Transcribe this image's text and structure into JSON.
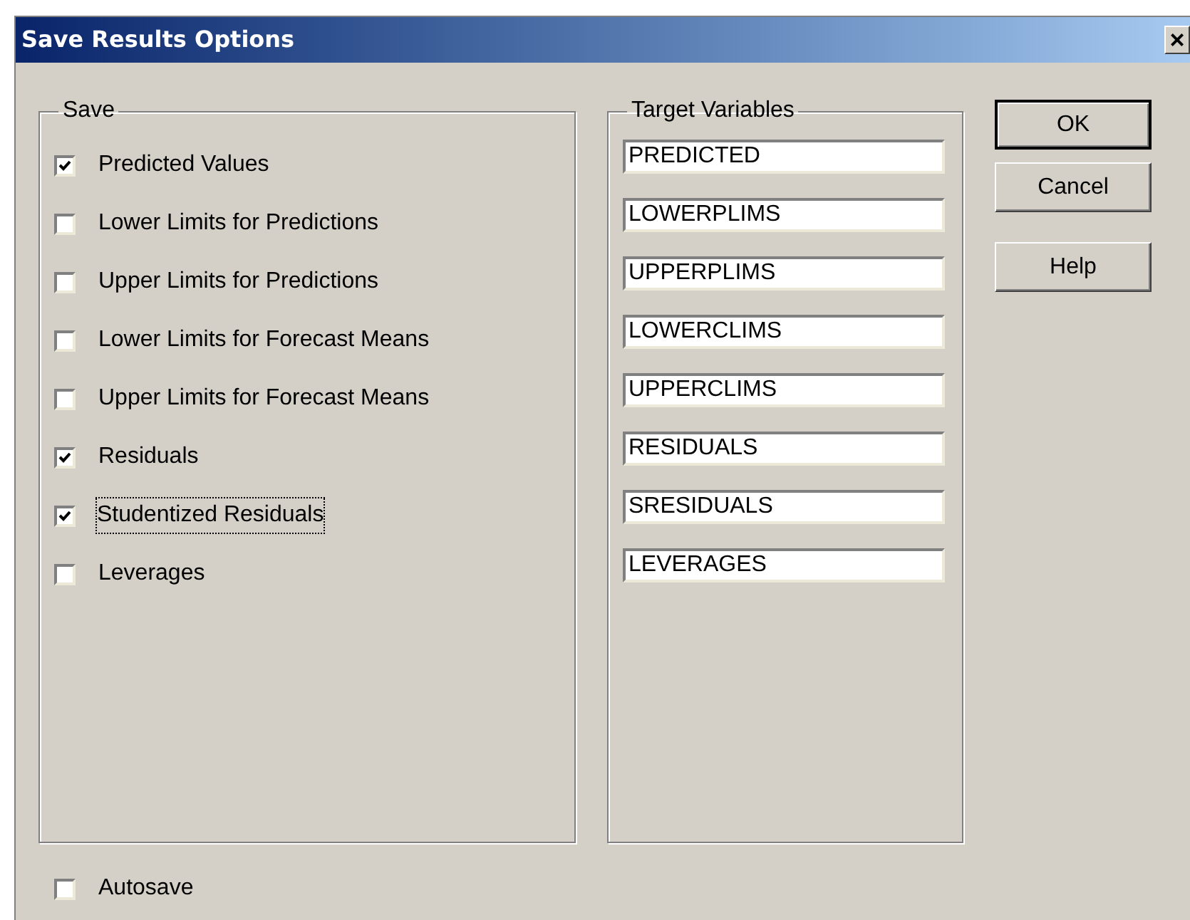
{
  "window": {
    "title": "Save Results Options",
    "close": "×"
  },
  "save_group": {
    "label": "Save",
    "options": [
      {
        "label": "Predicted Values",
        "checked": true,
        "focused": false
      },
      {
        "label": "Lower Limits for Predictions",
        "checked": false,
        "focused": false
      },
      {
        "label": "Upper Limits for Predictions",
        "checked": false,
        "focused": false
      },
      {
        "label": "Lower Limits for Forecast Means",
        "checked": false,
        "focused": false
      },
      {
        "label": "Upper Limits for Forecast Means",
        "checked": false,
        "focused": false
      },
      {
        "label": "Residuals",
        "checked": true,
        "focused": false
      },
      {
        "label": "Studentized Residuals",
        "checked": true,
        "focused": true
      },
      {
        "label": "Leverages",
        "checked": false,
        "focused": false
      }
    ]
  },
  "target_group": {
    "label": "Target Variables",
    "fields": [
      "PREDICTED",
      "LOWERPLIMS",
      "UPPERPLIMS",
      "LOWERCLIMS",
      "UPPERCLIMS",
      "RESIDUALS",
      "SRESIDUALS",
      "LEVERAGES"
    ]
  },
  "buttons": [
    {
      "label": "OK",
      "default": true
    },
    {
      "label": "Cancel",
      "default": false
    },
    {
      "label": "Help",
      "default": false
    }
  ],
  "autosave": {
    "label": "Autosave",
    "checked": false
  }
}
